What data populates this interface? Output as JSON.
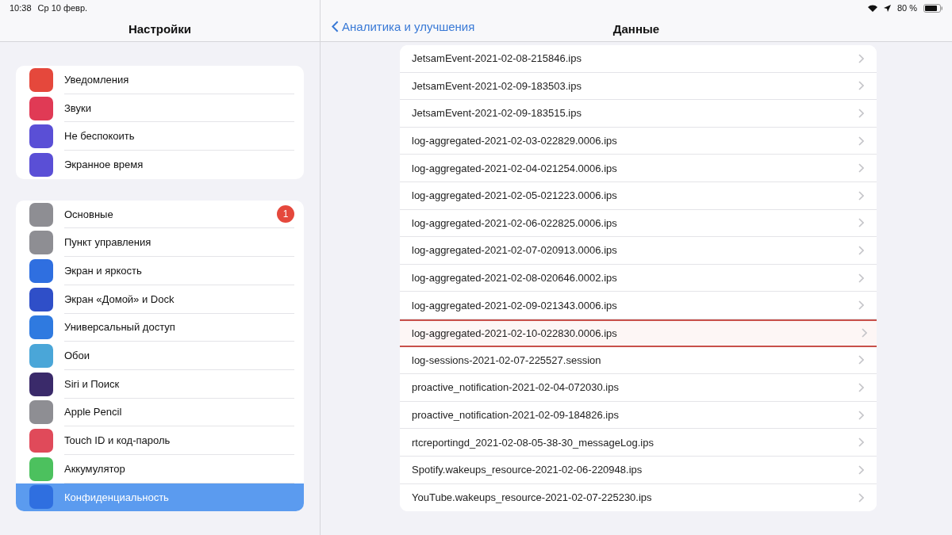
{
  "status_bar": {
    "time": "10:38",
    "date": "Ср 10 февр.",
    "battery": "80 %"
  },
  "sidebar": {
    "title": "Настройки",
    "groups": [
      {
        "items": [
          {
            "label": "Уведомления",
            "color": "#e5483c",
            "selected": false
          },
          {
            "label": "Звуки",
            "color": "#e03a55",
            "selected": false
          },
          {
            "label": "Не беспокоить",
            "color": "#5a4fd6",
            "selected": false
          },
          {
            "label": "Экранное время",
            "color": "#5a4fd6",
            "selected": false
          }
        ]
      },
      {
        "items": [
          {
            "label": "Основные",
            "color": "#8e8e93",
            "selected": false,
            "badge": "1"
          },
          {
            "label": "Пункт управления",
            "color": "#8e8e93",
            "selected": false
          },
          {
            "label": "Экран и яркость",
            "color": "#2f6fe0",
            "selected": false
          },
          {
            "label": "Экран «Домой» и Dock",
            "color": "#2f4fc8",
            "selected": false
          },
          {
            "label": "Универсальный доступ",
            "color": "#2f7ae0",
            "selected": false
          },
          {
            "label": "Обои",
            "color": "#4aa6d8",
            "selected": false
          },
          {
            "label": "Siri и Поиск",
            "color": "#3a2a6a",
            "selected": false
          },
          {
            "label": "Apple Pencil",
            "color": "#8e8e93",
            "selected": false
          },
          {
            "label": "Touch ID и код-пароль",
            "color": "#e04a5a",
            "selected": false
          },
          {
            "label": "Аккумулятор",
            "color": "#4cc15e",
            "selected": false
          },
          {
            "label": "Конфиденциальность",
            "color": "#2f6fe0",
            "selected": true
          }
        ]
      }
    ]
  },
  "detail": {
    "back": "Аналитика и улучшения",
    "title": "Данные",
    "rows": [
      {
        "label": "JetsamEvent-2021-02-08-215846.ips",
        "selected": false
      },
      {
        "label": "JetsamEvent-2021-02-09-183503.ips",
        "selected": false
      },
      {
        "label": "JetsamEvent-2021-02-09-183515.ips",
        "selected": false
      },
      {
        "label": "log-aggregated-2021-02-03-022829.0006.ips",
        "selected": false
      },
      {
        "label": "log-aggregated-2021-02-04-021254.0006.ips",
        "selected": false
      },
      {
        "label": "log-aggregated-2021-02-05-021223.0006.ips",
        "selected": false
      },
      {
        "label": "log-aggregated-2021-02-06-022825.0006.ips",
        "selected": false
      },
      {
        "label": "log-aggregated-2021-02-07-020913.0006.ips",
        "selected": false
      },
      {
        "label": "log-aggregated-2021-02-08-020646.0002.ips",
        "selected": false
      },
      {
        "label": "log-aggregated-2021-02-09-021343.0006.ips",
        "selected": false
      },
      {
        "label": "log-aggregated-2021-02-10-022830.0006.ips",
        "selected": true
      },
      {
        "label": "log-sessions-2021-02-07-225527.session",
        "selected": false
      },
      {
        "label": "proactive_notification-2021-02-04-072030.ips",
        "selected": false
      },
      {
        "label": "proactive_notification-2021-02-09-184826.ips",
        "selected": false
      },
      {
        "label": "rtcreportingd_2021-02-08-05-38-30_messageLog.ips",
        "selected": false
      },
      {
        "label": "Spotify.wakeups_resource-2021-02-06-220948.ips",
        "selected": false
      },
      {
        "label": "YouTube.wakeups_resource-2021-02-07-225230.ips",
        "selected": false
      }
    ]
  }
}
